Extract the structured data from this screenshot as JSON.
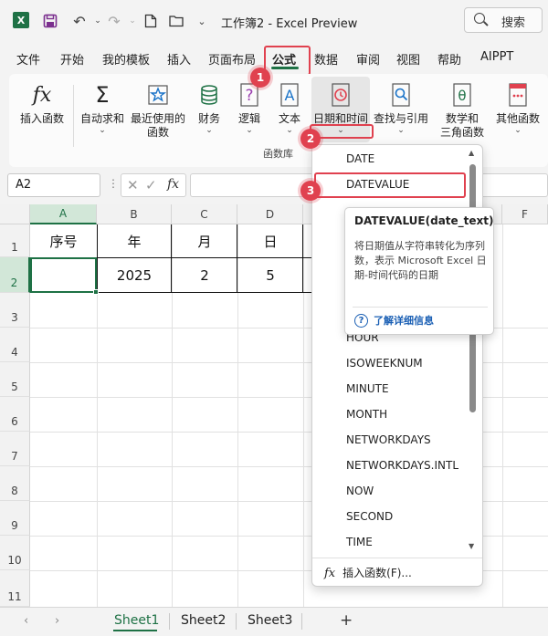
{
  "window": {
    "title": "工作簿2 - Excel Preview",
    "search_placeholder": "搜索"
  },
  "menu": {
    "tabs": [
      "文件",
      "开始",
      "我的模板",
      "插入",
      "页面布局",
      "公式",
      "数据",
      "审阅",
      "视图",
      "帮助",
      "AIPPT"
    ],
    "active": "公式"
  },
  "ribbon": {
    "buttons": {
      "insert_function": "插入函数",
      "autosum": "自动求和",
      "recent_1": "最近使用的",
      "recent_2": "函数",
      "financial": "财务",
      "logical": "逻辑",
      "text": "文本",
      "datetime": "日期和时间",
      "lookup": "查找与引用",
      "math_1": "数学和",
      "math_2": "三角函数",
      "more": "其他函数"
    },
    "group_label": "函数库"
  },
  "formula_bar": {
    "name_box": "A2",
    "fx": "fx"
  },
  "grid": {
    "columns": [
      "A",
      "B",
      "C",
      "D",
      "F"
    ],
    "rows": [
      "1",
      "2",
      "3",
      "4",
      "5",
      "6",
      "7",
      "8",
      "9",
      "10",
      "11"
    ],
    "header_row": [
      "序号",
      "年",
      "月",
      "日"
    ],
    "data_row": [
      "",
      "2025",
      "2",
      "5"
    ]
  },
  "sheets": [
    "Sheet1",
    "Sheet2",
    "Sheet3"
  ],
  "dropdown": {
    "items_top": [
      "DATE",
      "DATEVALUE"
    ],
    "items_bottom": [
      "HOUR",
      "ISOWEEKNUM",
      "MINUTE",
      "MONTH",
      "NETWORKDAYS",
      "NETWORKDAYS.INTL",
      "NOW",
      "SECOND",
      "TIME"
    ],
    "insert_function": "插入函数(F)..."
  },
  "tooltip": {
    "title": "DATEVALUE(date_text)",
    "description": "将日期值从字符串转化为序列数，表示 Microsoft Excel 日期-时间代码的日期",
    "help_link": "了解详细信息"
  },
  "annotations": [
    "1",
    "2",
    "3"
  ],
  "colors": {
    "accent": "#1e7145",
    "highlight": "#e0414f",
    "link": "#1a5fb4"
  }
}
